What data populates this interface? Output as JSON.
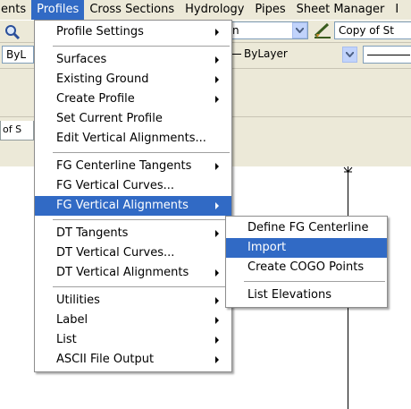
{
  "menubar": {
    "items": [
      "ents",
      "Profiles",
      "Cross Sections",
      "Hydrology",
      "Pipes",
      "Sheet Manager",
      "I"
    ],
    "active_index": 1
  },
  "toolbar": {
    "combo1_text": "n",
    "combo2_text": "Copy of St",
    "layer_left_text": "ByL",
    "layer_combo_text": "ByLayer",
    "tab_text": "of S"
  },
  "profiles_menu": {
    "items": [
      {
        "label": "Profile Settings",
        "arrow": true
      },
      {
        "sep": true
      },
      {
        "label": "Surfaces",
        "arrow": true
      },
      {
        "label": "Existing Ground",
        "arrow": true
      },
      {
        "label": "Create Profile",
        "arrow": true
      },
      {
        "label": "Set Current Profile",
        "arrow": false
      },
      {
        "label": "Edit Vertical Alignments...",
        "arrow": false
      },
      {
        "sep": true
      },
      {
        "label": "FG Centerline Tangents",
        "arrow": true
      },
      {
        "label": "FG Vertical Curves...",
        "arrow": false
      },
      {
        "label": "FG Vertical Alignments",
        "arrow": true,
        "highlighted": true
      },
      {
        "sep": true
      },
      {
        "label": "DT Tangents",
        "arrow": true
      },
      {
        "label": "DT Vertical Curves...",
        "arrow": false
      },
      {
        "label": "DT Vertical Alignments",
        "arrow": true
      },
      {
        "sep": true
      },
      {
        "label": "Utilities",
        "arrow": true
      },
      {
        "label": "Label",
        "arrow": true
      },
      {
        "label": "List",
        "arrow": true
      },
      {
        "label": "ASCII File Output",
        "arrow": true
      }
    ]
  },
  "submenu": {
    "items": [
      {
        "label": "Define FG Centerline"
      },
      {
        "label": "Import",
        "highlighted": true
      },
      {
        "label": "Create COGO Points"
      },
      {
        "sep": true
      },
      {
        "label": "List Elevations"
      }
    ]
  },
  "colors": {
    "highlight": "#316ac5",
    "chrome": "#ece9d8"
  },
  "icons": [
    "zoom-icon",
    "dropdown-arrow-icon",
    "pen-style-icon",
    "submenu-arrow-icon"
  ]
}
